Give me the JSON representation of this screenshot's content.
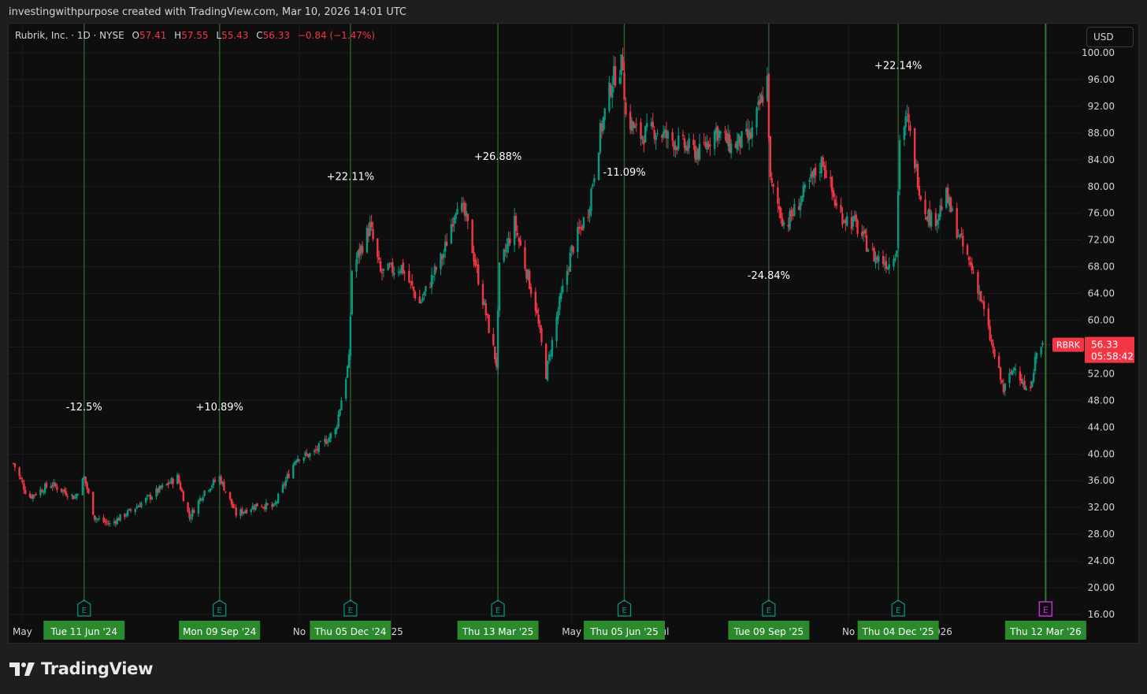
{
  "header": {
    "credit": "investingwithpurpose created with TradingView.com, Mar 10, 2026 14:01 UTC"
  },
  "legend": {
    "symbol": "Rubrik, Inc. · 1D · NYSE",
    "open_label": "O",
    "open": "57.41",
    "high_label": "H",
    "high": "57.55",
    "low_label": "L",
    "low": "55.43",
    "close_label": "C",
    "close": "56.33",
    "change": "−0.84 (−1.47%)"
  },
  "currency_button": "USD",
  "brand": {
    "name": "TradingView"
  },
  "colors": {
    "background": "#0e0e0f",
    "up": "#089981",
    "down": "#f23645",
    "earnings_line": "#2e5a2e",
    "earnings_label_bg": "#2b8a2b",
    "future_earnings_marker": "#c22ed1"
  },
  "chart_data": {
    "type": "candlestick",
    "symbol": "RBRK",
    "y_ticks": [
      "100.00",
      "96.00",
      "92.00",
      "88.00",
      "84.00",
      "80.00",
      "76.00",
      "72.00",
      "68.00",
      "64.00",
      "60.00",
      "56.00",
      "52.00",
      "48.00",
      "44.00",
      "40.00",
      "36.00",
      "32.00",
      "28.00",
      "24.00",
      "20.00",
      "16.00"
    ],
    "ylim": [
      16,
      100
    ],
    "date_range": [
      "2024-04-25",
      "2026-03-16"
    ],
    "x_labels": [
      {
        "date": "2024-05-01",
        "text": "May"
      },
      {
        "date": "2024-11-01",
        "text": "No"
      },
      {
        "date": "2025-01-01",
        "text": "2025"
      },
      {
        "date": "2025-05-01",
        "text": "May"
      },
      {
        "date": "2025-07-01",
        "text": "Jul"
      },
      {
        "date": "2025-11-01",
        "text": "No"
      },
      {
        "date": "2026-01-01",
        "text": "2026"
      }
    ],
    "earnings": [
      {
        "date": "2024-06-11",
        "label": "Tue 11 Jun '24",
        "change": "-12.5%",
        "change_price": 46.5,
        "marker": "E"
      },
      {
        "date": "2024-09-09",
        "label": "Mon 09 Sep '24",
        "change": "+10.89%",
        "change_price": 46.5,
        "marker": "E"
      },
      {
        "date": "2024-12-05",
        "label": "Thu 05 Dec '24",
        "change": "+22.11%",
        "change_price": 81.0,
        "marker": "E"
      },
      {
        "date": "2025-03-13",
        "label": "Thu 13 Mar '25",
        "change": "+26.88%",
        "change_price": 84.0,
        "marker": "E"
      },
      {
        "date": "2025-06-05",
        "label": "Thu 05 Jun '25",
        "change": "-11.09%",
        "change_price": 81.6,
        "marker": "E"
      },
      {
        "date": "2025-09-09",
        "label": "Tue 09 Sep '25",
        "change": "-24.84%",
        "change_price": 66.2,
        "marker": "E"
      },
      {
        "date": "2025-12-04",
        "label": "Thu 04 Dec '25",
        "change": "+22.14%",
        "change_price": 97.6,
        "marker": "E"
      },
      {
        "date": "2026-03-12",
        "label": "Thu 12 Mar '26",
        "change": "",
        "change_price": null,
        "marker": "E",
        "upcoming": true
      }
    ],
    "price_path": [
      [
        "2024-04-25",
        38.6
      ],
      [
        "2024-05-05",
        33.5
      ],
      [
        "2024-05-20",
        35.5
      ],
      [
        "2024-06-05",
        33.5
      ],
      [
        "2024-06-11",
        36.5
      ],
      [
        "2024-06-18",
        30.5
      ],
      [
        "2024-06-28",
        29.5
      ],
      [
        "2024-07-12",
        31.5
      ],
      [
        "2024-07-30",
        34.5
      ],
      [
        "2024-08-12",
        36.5
      ],
      [
        "2024-08-20",
        30.5
      ],
      [
        "2024-08-30",
        34.5
      ],
      [
        "2024-09-09",
        36.5
      ],
      [
        "2024-09-20",
        31.0
      ],
      [
        "2024-10-05",
        32.5
      ],
      [
        "2024-10-15",
        32.0
      ],
      [
        "2024-10-30",
        39.5
      ],
      [
        "2024-11-10",
        40.0
      ],
      [
        "2024-11-25",
        43.5
      ],
      [
        "2024-12-04",
        54.0
      ],
      [
        "2024-12-06",
        67.5
      ],
      [
        "2024-12-18",
        74.0
      ],
      [
        "2024-12-25",
        67.0
      ],
      [
        "2025-01-08",
        68.0
      ],
      [
        "2025-01-20",
        62.5
      ],
      [
        "2025-02-05",
        70.0
      ],
      [
        "2025-02-14",
        78.0
      ],
      [
        "2025-02-20",
        75.0
      ],
      [
        "2025-03-04",
        62.0
      ],
      [
        "2025-03-12",
        53.5
      ],
      [
        "2025-03-14",
        67.5
      ],
      [
        "2025-03-24",
        74.5
      ],
      [
        "2025-04-07",
        62.0
      ],
      [
        "2025-04-14",
        52.0
      ],
      [
        "2025-04-22",
        61.5
      ],
      [
        "2025-05-01",
        70.5
      ],
      [
        "2025-05-12",
        76.5
      ],
      [
        "2025-05-20",
        88.0
      ],
      [
        "2025-05-28",
        96.0
      ],
      [
        "2025-06-04",
        98.5
      ],
      [
        "2025-06-06",
        90.5
      ],
      [
        "2025-06-15",
        87.5
      ],
      [
        "2025-06-25",
        88.5
      ],
      [
        "2025-07-10",
        86.5
      ],
      [
        "2025-07-25",
        85.0
      ],
      [
        "2025-08-05",
        88.5
      ],
      [
        "2025-08-15",
        86.0
      ],
      [
        "2025-08-28",
        87.5
      ],
      [
        "2025-09-08",
        96.0
      ],
      [
        "2025-09-10",
        80.5
      ],
      [
        "2025-09-20",
        74.0
      ],
      [
        "2025-10-05",
        80.0
      ],
      [
        "2025-10-15",
        84.0
      ],
      [
        "2025-10-25",
        76.0
      ],
      [
        "2025-11-05",
        74.5
      ],
      [
        "2025-11-18",
        69.5
      ],
      [
        "2025-11-28",
        68.5
      ],
      [
        "2025-12-03",
        71.0
      ],
      [
        "2025-12-05",
        87.5
      ],
      [
        "2025-12-10",
        90.0
      ],
      [
        "2025-12-20",
        77.5
      ],
      [
        "2025-12-27",
        74.5
      ],
      [
        "2026-01-05",
        78.5
      ],
      [
        "2026-01-15",
        71.5
      ],
      [
        "2026-01-25",
        66.0
      ],
      [
        "2026-02-05",
        55.5
      ],
      [
        "2026-02-12",
        49.5
      ],
      [
        "2026-02-20",
        53.5
      ],
      [
        "2026-02-28",
        48.5
      ],
      [
        "2026-03-06",
        55.0
      ],
      [
        "2026-03-10",
        56.33
      ]
    ],
    "last_price": {
      "symbol": "RBRK",
      "value": "56.33",
      "countdown": "05:58:42"
    }
  }
}
